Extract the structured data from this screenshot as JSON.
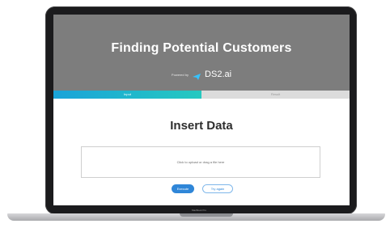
{
  "hero": {
    "title": "Finding Potential Customers",
    "powered_label": "Powered by",
    "brand": "DS2.ai"
  },
  "progress": {
    "fraction": 0.5,
    "steps": [
      "Input",
      "Result"
    ]
  },
  "main": {
    "title": "Insert Data",
    "dropzone_text": "Click to upload or drag a file here",
    "buttons": {
      "primary": "Execute",
      "secondary": "Try again"
    }
  },
  "device": {
    "model_label": "MacBook Pro"
  },
  "colors": {
    "hero_bg": "#7d7d7d",
    "accent": "#2f86d8",
    "progress_start": "#1aa3d9",
    "progress_end": "#25c9c0"
  }
}
